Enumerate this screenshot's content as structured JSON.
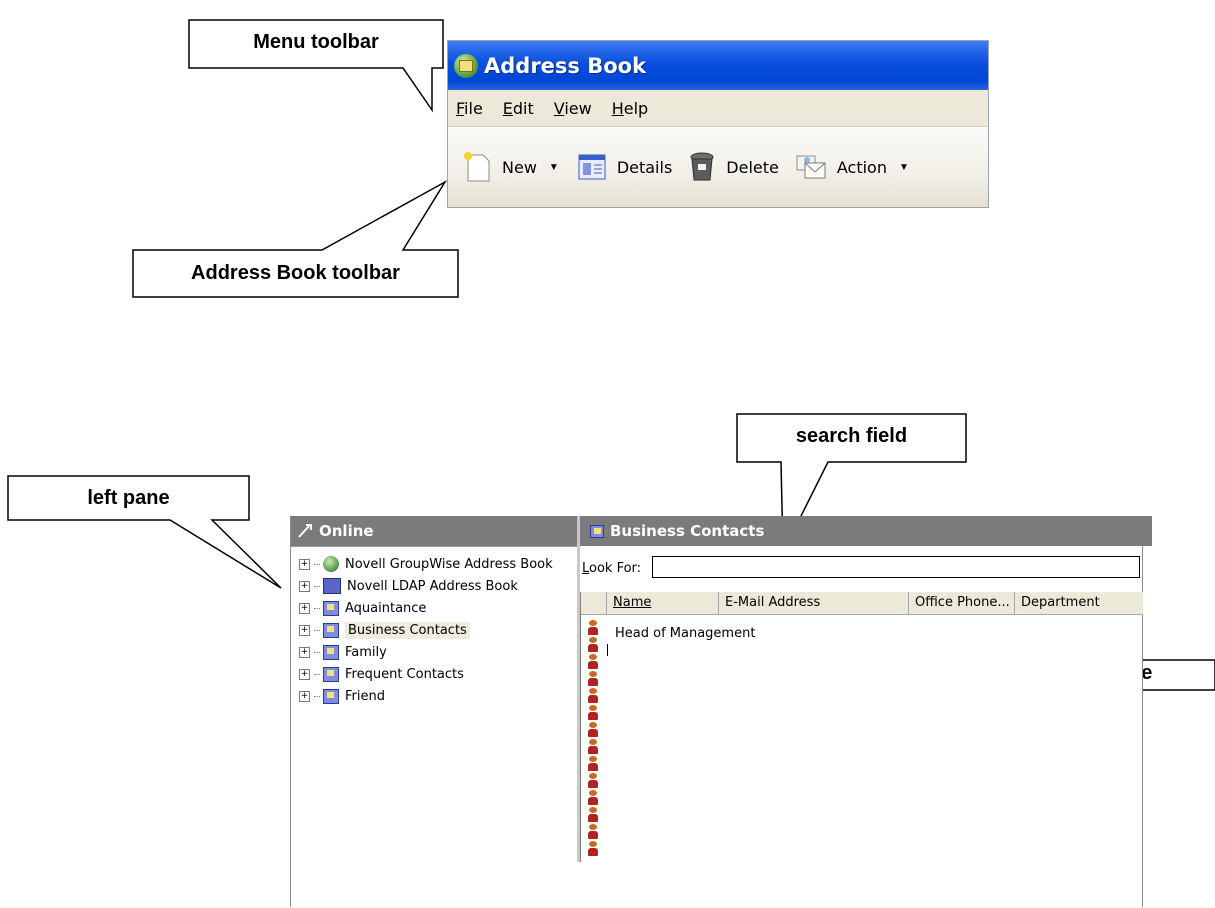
{
  "callouts": {
    "menu_toolbar": "Menu toolbar",
    "address_book_toolbar": "Address Book toolbar",
    "left_pane": "left pane",
    "search_field": "search field",
    "right_pane": "right pane"
  },
  "top_window": {
    "title": "Address Book",
    "menu": [
      {
        "u": "F",
        "rest": "ile"
      },
      {
        "u": "E",
        "rest": "dit"
      },
      {
        "u": "V",
        "rest": "iew"
      },
      {
        "u": "H",
        "rest": "elp"
      }
    ],
    "toolbar": {
      "new_label": "New",
      "details_label": "Details",
      "delete_label": "Delete",
      "action_label": "Action"
    }
  },
  "left_pane": {
    "header": "Online",
    "items": [
      {
        "label": "Novell GroupWise Address Book",
        "icon": "globe-book-icon"
      },
      {
        "label": "Novell LDAP Address Book",
        "icon": "ldap-book-icon"
      },
      {
        "label": "Aquaintance",
        "icon": "address-book-icon"
      },
      {
        "label": "Business Contacts",
        "icon": "address-book-icon",
        "selected": true
      },
      {
        "label": "Family",
        "icon": "address-book-icon"
      },
      {
        "label": "Frequent Contacts",
        "icon": "address-book-icon"
      },
      {
        "label": "Friend",
        "icon": "address-book-icon"
      }
    ]
  },
  "right_pane": {
    "header": "Business Contacts",
    "look_for_label": "Look For:",
    "look_for_value": "",
    "columns": [
      "Name",
      "E-Mail Address",
      "Office Phone...",
      "Department"
    ],
    "rows": [
      "Head of Management"
    ],
    "contact_icon_count": 14
  }
}
